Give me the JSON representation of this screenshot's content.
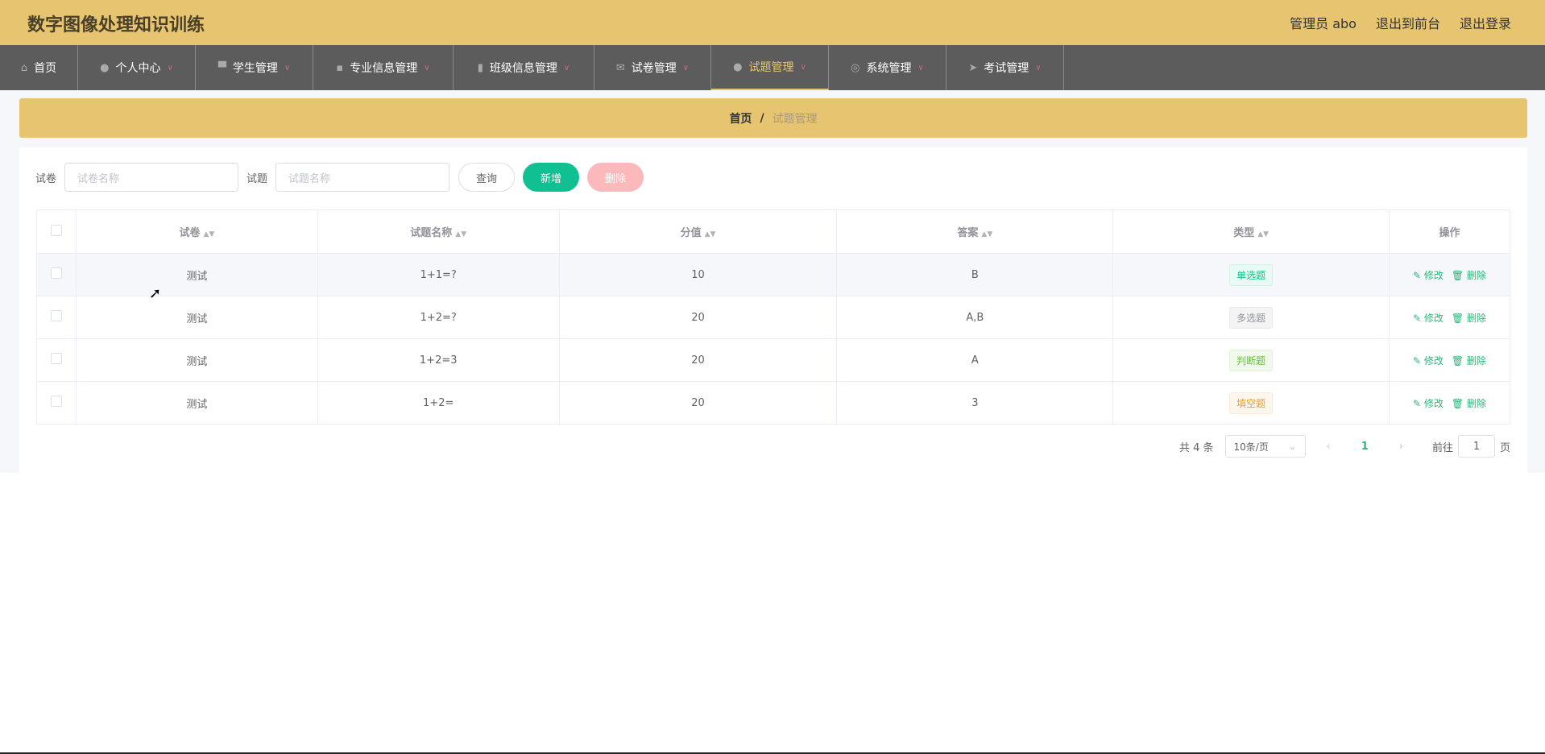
{
  "header": {
    "title": "数字图像处理知识训练",
    "user": "管理员 abo",
    "to_front": "退出到前台",
    "logout": "退出登录"
  },
  "nav": [
    {
      "label": "首页",
      "icon": "home-icon"
    },
    {
      "label": "个人中心",
      "icon": "user-icon"
    },
    {
      "label": "学生管理",
      "icon": "monitor-icon"
    },
    {
      "label": "专业信息管理",
      "icon": "chat-icon"
    },
    {
      "label": "班级信息管理",
      "icon": "clipboard-icon"
    },
    {
      "label": "试卷管理",
      "icon": "mail-icon"
    },
    {
      "label": "试题管理",
      "icon": "user-icon"
    },
    {
      "label": "系统管理",
      "icon": "compass-icon"
    },
    {
      "label": "考试管理",
      "icon": "send-icon"
    }
  ],
  "breadcrumb": {
    "home": "首页",
    "sep": "/",
    "current": "试题管理"
  },
  "search": {
    "paper_label": "试卷",
    "paper_placeholder": "试卷名称",
    "question_label": "试题",
    "question_placeholder": "试题名称",
    "query": "查询",
    "add": "新增",
    "delete": "删除"
  },
  "table": {
    "headers": [
      "试卷",
      "试题名称",
      "分值",
      "答案",
      "类型",
      "操作"
    ],
    "rows": [
      {
        "paper": "测试",
        "name": "1+1=?",
        "score": "10",
        "answer": "B",
        "type": "单选题"
      },
      {
        "paper": "测试",
        "name": "1+2=?",
        "score": "20",
        "answer": "A,B",
        "type": "多选题"
      },
      {
        "paper": "测试",
        "name": "1+2=3",
        "score": "20",
        "answer": "A",
        "type": "判断题"
      },
      {
        "paper": "测试",
        "name": "1+2=",
        "score": "20",
        "answer": "3",
        "type": "填空题"
      }
    ],
    "edit": "修改",
    "remove": "删除"
  },
  "pagination": {
    "total": "共 4 条",
    "page_size": "10条/页",
    "current": "1",
    "goto": "前往",
    "goto_value": "1",
    "page_unit": "页"
  },
  "colors": {
    "gold": "#e7c570",
    "nav": "#5c5c5c",
    "green": "#2cb57a"
  }
}
